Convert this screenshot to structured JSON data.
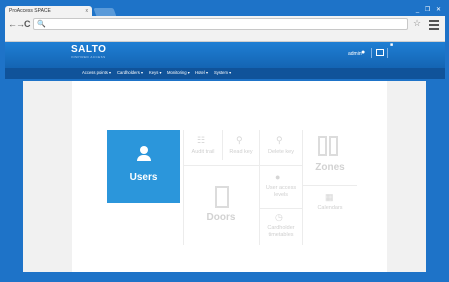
{
  "browser": {
    "tab_title": "ProAccess SPACE",
    "tab_close": "x",
    "window_controls": "_ ❐ ✕",
    "back": "←",
    "forward": "→",
    "reload": "C",
    "url_icon": "🔍",
    "url_value": "",
    "star": "☆"
  },
  "header": {
    "logo": "SALTO",
    "logo_sub": "INSPIRED ACCESS",
    "username": "admin"
  },
  "nav": {
    "items": [
      {
        "label": "Access points ▾"
      },
      {
        "label": "Cardholders ▾"
      },
      {
        "label": "Keys ▾"
      },
      {
        "label": "Monitoring ▾"
      },
      {
        "label": "Hotel ▾"
      },
      {
        "label": "System ▾"
      }
    ]
  },
  "tiles": {
    "users": "Users",
    "audit_trail": "Audit trail",
    "read_key": "Read key",
    "delete_key": "Delete key",
    "zones": "Zones",
    "user_access_levels_1": "User access",
    "user_access_levels_2": "levels",
    "calendars": "Calendars",
    "doors": "Doors",
    "limitations_1": "Cardholder",
    "limitations_2": "timetables"
  },
  "colors": {
    "brand_blue": "#1e73c8",
    "nav_dark": "#10539a",
    "users_tile": "#2b96db"
  }
}
